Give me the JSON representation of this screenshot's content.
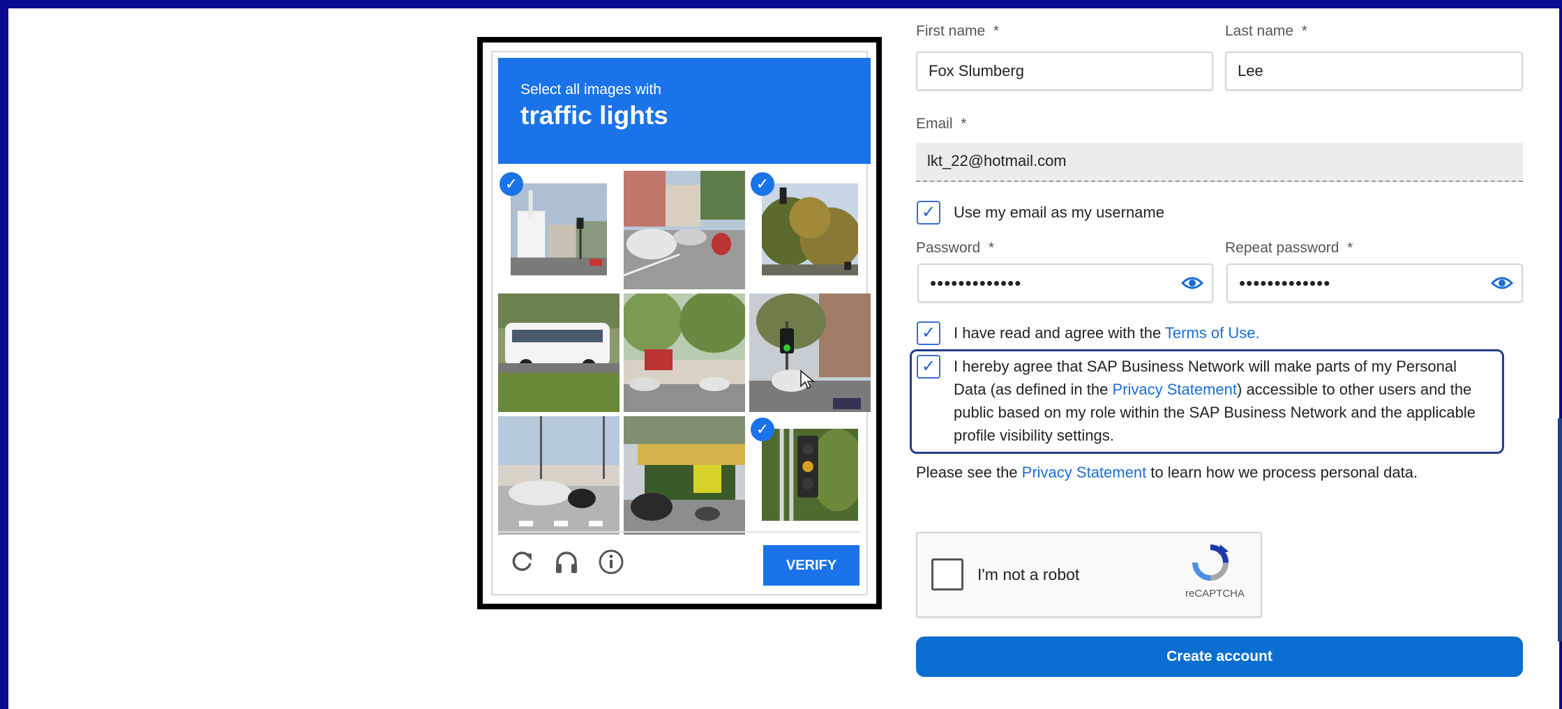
{
  "captcha": {
    "prompt_small": "Select all images with",
    "prompt_big": "traffic lights",
    "verify_label": "VERIFY",
    "footer_icons": [
      "reload-icon",
      "headphones-icon",
      "info-icon"
    ],
    "tiles": [
      {
        "name": "street-church",
        "selected": true,
        "scene": "church"
      },
      {
        "name": "street-cars-motorcycle",
        "selected": false,
        "scene": "cars"
      },
      {
        "name": "trees-traffic-light",
        "selected": true,
        "scene": "trees"
      },
      {
        "name": "white-bus",
        "selected": false,
        "scene": "bus"
      },
      {
        "name": "street-trees",
        "selected": false,
        "scene": "street"
      },
      {
        "name": "traffic-light-tree",
        "selected": false,
        "scene": "light"
      },
      {
        "name": "intersection-car",
        "selected": false,
        "scene": "intersection"
      },
      {
        "name": "shop-front",
        "selected": false,
        "scene": "shop"
      },
      {
        "name": "traffic-light-closeup",
        "selected": true,
        "scene": "closeup"
      }
    ]
  },
  "form": {
    "first_name_label": "First name",
    "last_name_label": "Last name",
    "first_name_value": "Fox Slumberg",
    "last_name_value": "Lee",
    "email_label": "Email",
    "email_value": "lkt_22@hotmail.com",
    "use_email_label": "Use my email as my username",
    "password_label": "Password",
    "repeat_password_label": "Repeat password",
    "password_value": "•••••••••••••",
    "repeat_password_value": "•••••••••••••",
    "required_mark": "*",
    "terms_prefix": "I have read and agree with the ",
    "terms_link": "Terms of Use.",
    "consent_line1": "I hereby agree that SAP Business Network will make parts of my Personal",
    "consent_line2_prefix": "Data (as defined in the ",
    "consent_link": "Privacy Statement",
    "consent_line2_suffix": ") accessible to other users and the",
    "consent_line3": "public based on my role within the SAP Business Network and the applicable",
    "consent_line4": "profile visibility settings.",
    "privacy_prefix": "Please see the ",
    "privacy_link": "Privacy Statement",
    "privacy_suffix": " to learn how we process personal data.",
    "recaptcha_label": "I'm not a robot",
    "recaptcha_brand": "reCAPTCHA",
    "create_label": "Create account",
    "check_glyph": "✓"
  },
  "colors": {
    "frame": "#0a0a8c",
    "captcha_blue": "#1a73e8",
    "link": "#1a6ed2",
    "primary_button": "#0a6ed1",
    "consent_border": "#223e86"
  }
}
